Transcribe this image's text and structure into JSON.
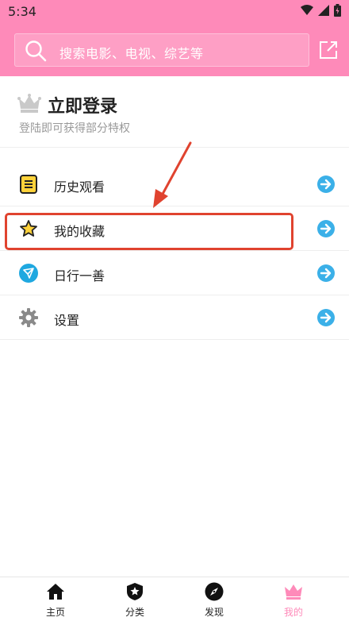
{
  "status_bar": {
    "time": "5:34"
  },
  "search": {
    "placeholder": "搜索电影、电视、综艺等"
  },
  "login": {
    "title": "立即登录",
    "subtitle": "登陆即可获得部分特权"
  },
  "menu": {
    "items": [
      {
        "label": "历史观看",
        "icon": "history-icon"
      },
      {
        "label": "我的收藏",
        "icon": "star-icon"
      },
      {
        "label": "日行一善",
        "icon": "paper-plane-icon"
      },
      {
        "label": "设置",
        "icon": "gear-icon"
      }
    ]
  },
  "tabbar": {
    "tabs": [
      {
        "label": "主页",
        "icon": "home-icon"
      },
      {
        "label": "分类",
        "icon": "shield-star-icon"
      },
      {
        "label": "发现",
        "icon": "compass-icon"
      },
      {
        "label": "我的",
        "icon": "crown-icon",
        "active": true
      }
    ]
  },
  "colors": {
    "accent": "#fe8ab9",
    "annotation": "#e0432f",
    "arrow_badge": "#3bb0e8"
  }
}
